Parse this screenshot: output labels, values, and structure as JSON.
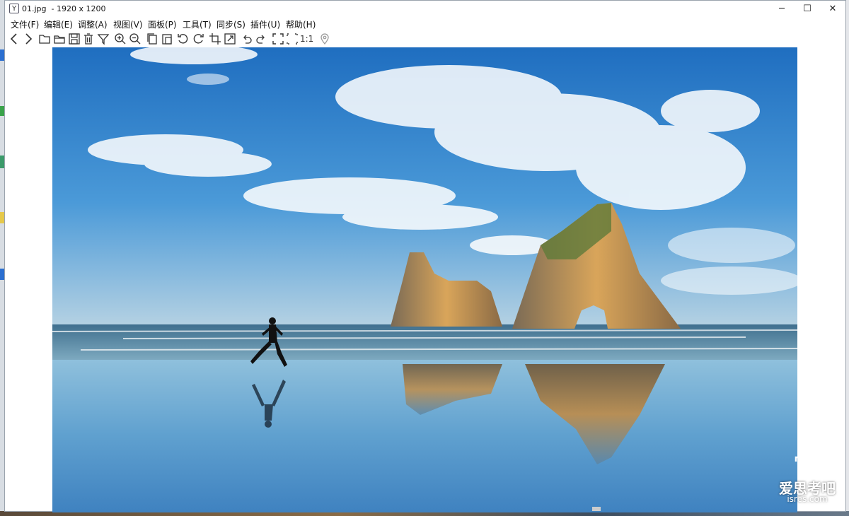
{
  "window": {
    "title": "01.jpg  - 1920 x 1200",
    "icon": "image-viewer-app-icon",
    "controls": {
      "minimize": "─",
      "maximize": "☐",
      "close": "✕"
    }
  },
  "menu": [
    {
      "label": "文件(F)"
    },
    {
      "label": "编辑(E)"
    },
    {
      "label": "调整(A)"
    },
    {
      "label": "视图(V)"
    },
    {
      "label": "面板(P)"
    },
    {
      "label": "工具(T)"
    },
    {
      "label": "同步(S)"
    },
    {
      "label": "插件(U)"
    },
    {
      "label": "帮助(H)"
    }
  ],
  "toolbar": {
    "icons": [
      "back-icon",
      "forward-icon",
      "open-file-icon",
      "open-folder-icon",
      "save-icon",
      "delete-icon",
      "filter-icon",
      "zoom-in-icon",
      "zoom-out-icon",
      "copy-icon",
      "paste-icon",
      "rotate-left-icon",
      "rotate-right-icon",
      "crop-icon",
      "resize-icon",
      "undo-icon",
      "redo-icon",
      "fullscreen-icon",
      "fit-icon",
      "actual-size-icon",
      "location-icon"
    ],
    "actual_size_label": "1:1"
  },
  "image": {
    "subject": "runner-on-beach-with-sea-arches",
    "sky_color": "#2f7fc9",
    "sand_color": "#6aa6cf"
  },
  "watermark": {
    "text": "爱思考吧",
    "sub": "isres.com"
  }
}
